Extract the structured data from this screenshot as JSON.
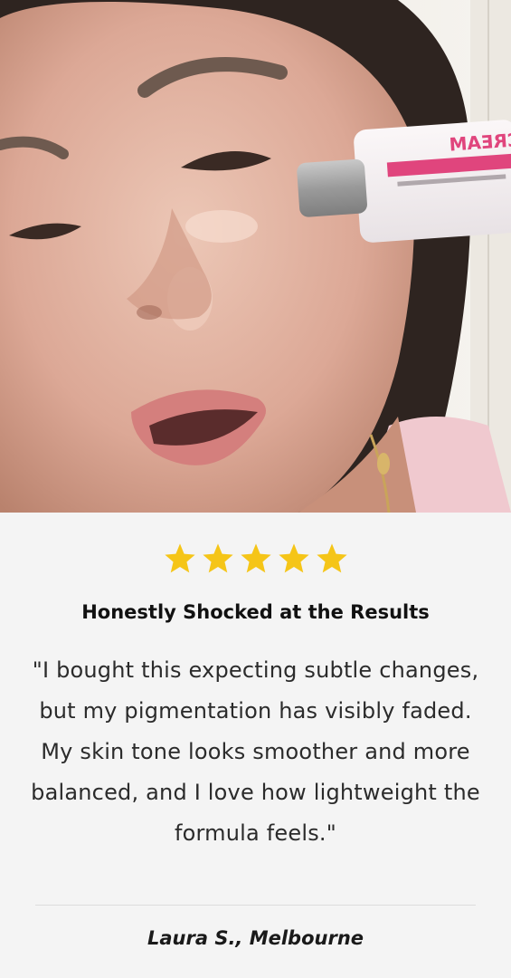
{
  "photo": {
    "product_label": "CREAM"
  },
  "review": {
    "rating": 5,
    "max_rating": 5,
    "star_color": "#f5c518",
    "title": "Honestly Shocked at the Results",
    "text": "\"I bought this expecting subtle changes, but my pigmentation has visibly faded. My skin tone looks smoother and more balanced, and I love how lightweight the formula feels.\"",
    "author": "Laura S., Melbourne"
  }
}
